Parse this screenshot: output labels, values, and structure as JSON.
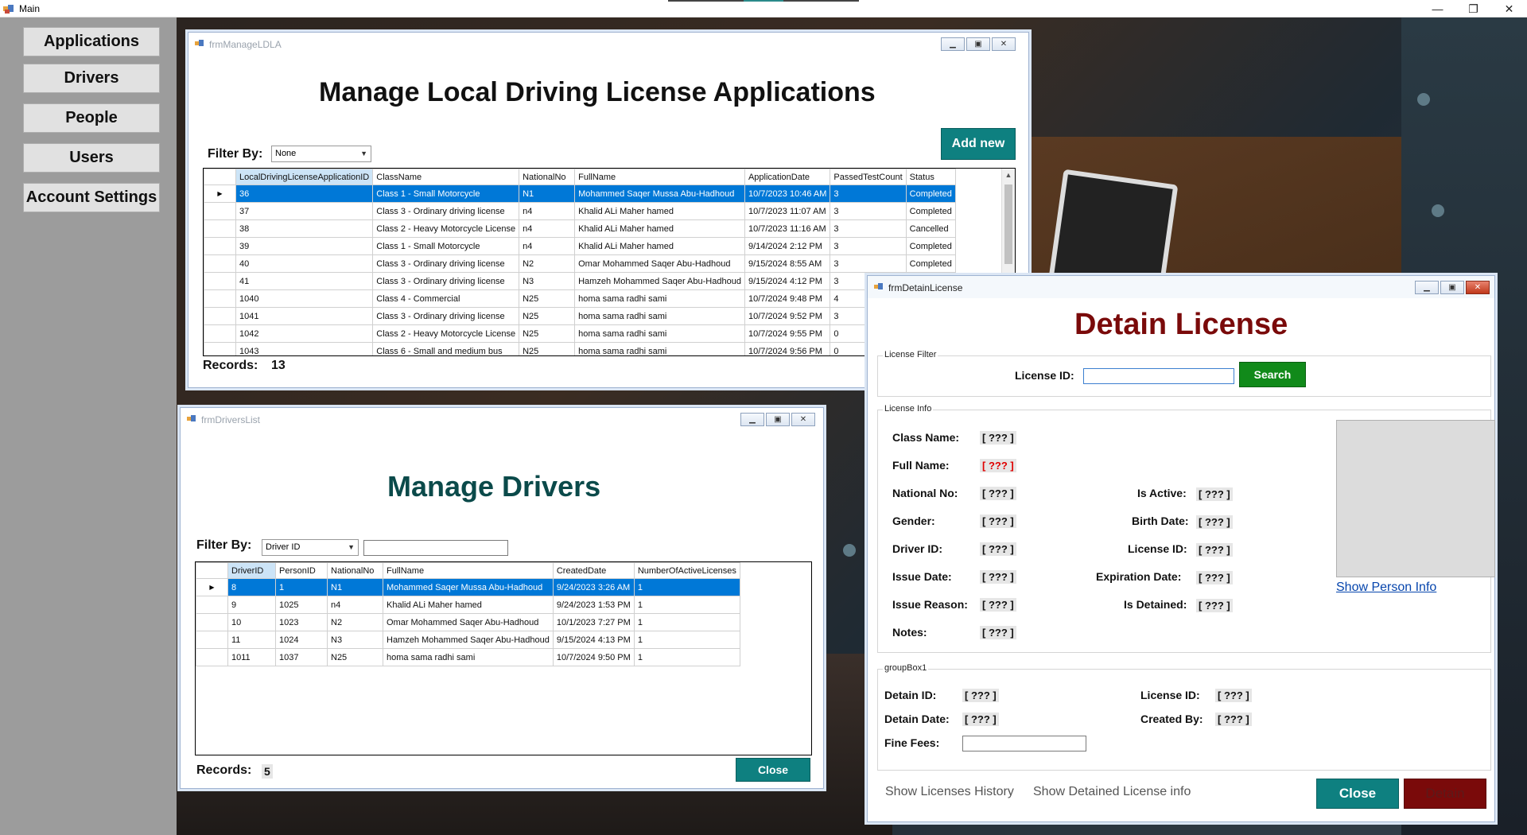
{
  "main": {
    "title": "Main",
    "controls": [
      "—",
      "❐",
      "✕"
    ]
  },
  "sidebar": {
    "items": [
      "Applications",
      "Drivers",
      "People",
      "Users",
      "Account Settings"
    ]
  },
  "ldla": {
    "window_title": "frmManageLDLA",
    "heading": "Manage Local Driving License Applications",
    "filter_label": "Filter By:",
    "filter_value": "None",
    "add_new": "Add new",
    "columns": [
      "LocalDrivingLicenseApplicationID",
      "ClassName",
      "NationalNo",
      "FullName",
      "ApplicationDate",
      "PassedTestCount",
      "Status"
    ],
    "rows": [
      [
        "36",
        "Class 1 - Small Motorcycle",
        "N1",
        "Mohammed Saqer Mussa Abu-Hadhoud",
        "10/7/2023 10:46 AM",
        "3",
        "Completed"
      ],
      [
        "37",
        "Class 3 - Ordinary driving license",
        "n4",
        "Khalid ALi Maher hamed",
        "10/7/2023 11:07 AM",
        "3",
        "Completed"
      ],
      [
        "38",
        "Class 2 - Heavy Motorcycle License",
        "n4",
        "Khalid ALi Maher hamed",
        "10/7/2023 11:16 AM",
        "3",
        "Cancelled"
      ],
      [
        "39",
        "Class 1 - Small Motorcycle",
        "n4",
        "Khalid ALi Maher hamed",
        "9/14/2024 2:12 PM",
        "3",
        "Completed"
      ],
      [
        "40",
        "Class 3 - Ordinary driving license",
        "N2",
        "Omar Mohammed Saqer Abu-Hadhoud",
        "9/15/2024 8:55 AM",
        "3",
        "Completed"
      ],
      [
        "41",
        "Class 3 - Ordinary driving license",
        "N3",
        "Hamzeh Mohammed Saqer Abu-Hadhoud",
        "9/15/2024 4:12 PM",
        "3",
        "Completed"
      ],
      [
        "1040",
        "Class 4 - Commercial",
        "N25",
        "homa sama radhi sami",
        "10/7/2024 9:48 PM",
        "4",
        ""
      ],
      [
        "1041",
        "Class 3 - Ordinary driving license",
        "N25",
        "homa sama radhi sami",
        "10/7/2024 9:52 PM",
        "3",
        ""
      ],
      [
        "1042",
        "Class 2 - Heavy Motorcycle License",
        "N25",
        "homa sama radhi sami",
        "10/7/2024 9:55 PM",
        "0",
        ""
      ],
      [
        "1043",
        "Class 6 - Small and medium bus",
        "N25",
        "homa sama radhi sami",
        "10/7/2024 9:56 PM",
        "0",
        ""
      ]
    ],
    "records_label": "Records:",
    "records_count": "13"
  },
  "drivers": {
    "window_title": "frmDriversList",
    "heading": "Manage Drivers",
    "filter_label": "Filter By:",
    "filter_value": "Driver ID",
    "columns": [
      "DriverID",
      "PersonID",
      "NationalNo",
      "FullName",
      "CreatedDate",
      "NumberOfActiveLicenses"
    ],
    "rows": [
      [
        "8",
        "1",
        "N1",
        "Mohammed Saqer Mussa Abu-Hadhoud",
        "9/24/2023 3:26 AM",
        "1"
      ],
      [
        "9",
        "1025",
        "n4",
        "Khalid ALi Maher hamed",
        "9/24/2023 1:53 PM",
        "1"
      ],
      [
        "10",
        "1023",
        "N2",
        "Omar Mohammed Saqer Abu-Hadhoud",
        "10/1/2023 7:27 PM",
        "1"
      ],
      [
        "11",
        "1024",
        "N3",
        "Hamzeh Mohammed Saqer Abu-Hadhoud",
        "9/15/2024 4:13 PM",
        "1"
      ],
      [
        "1011",
        "1037",
        "N25",
        "homa sama radhi sami",
        "10/7/2024 9:50 PM",
        "1"
      ]
    ],
    "records_label": "Records:",
    "records_count": "5",
    "close": "Close"
  },
  "detain": {
    "window_title": "frmDetainLicense",
    "heading": "Detain License",
    "filter_group": "License Filter",
    "license_id_label": "License ID:",
    "search": "Search",
    "info_group": "License Info",
    "fields": {
      "class_name": "Class Name:",
      "full_name": "Full Name:",
      "national_no": "National No:",
      "gender": "Gender:",
      "driver_id": "Driver ID:",
      "issue_date": "Issue Date:",
      "issue_reason": "Issue Reason:",
      "notes": "Notes:",
      "is_active": "Is Active:",
      "birth_date": "Birth Date:",
      "license_id": "License ID:",
      "expiration_date": "Expiration Date:",
      "is_detained": "Is Detained:"
    },
    "placeholder": "[ ??? ]",
    "show_person_info": "Show Person Info",
    "group2": "groupBox1",
    "detain_id": "Detain ID:",
    "detain_date": "Detain Date:",
    "fine_fees": "Fine Fees:",
    "license_id2": "License ID:",
    "created_by": "Created By:",
    "show_history": "Show Licenses History",
    "show_detained": "Show Detained License info",
    "close": "Close",
    "detain_btn": "Detain"
  }
}
